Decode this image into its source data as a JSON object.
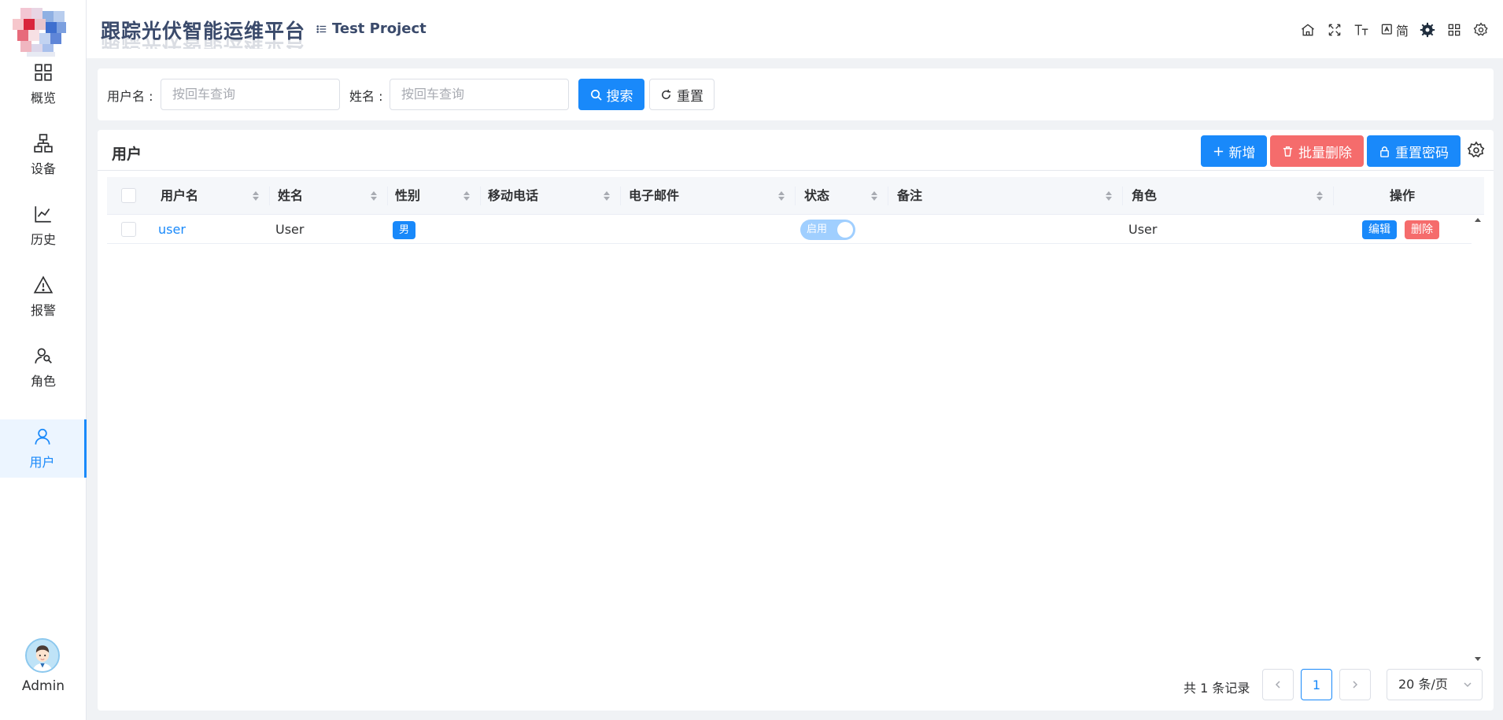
{
  "app": {
    "title": "跟踪光伏智能运维平台",
    "project": "Test Project"
  },
  "header_tools": {
    "lang_label": "简"
  },
  "sidebar": {
    "items": [
      {
        "label": "概览",
        "icon": "grid-icon"
      },
      {
        "label": "设备",
        "icon": "hierarchy-icon"
      },
      {
        "label": "历史",
        "icon": "line-chart-icon"
      },
      {
        "label": "报警",
        "icon": "warning-icon"
      },
      {
        "label": "角色",
        "icon": "roles-icon"
      },
      {
        "label": "用户",
        "icon": "user-icon",
        "active": true
      }
    ],
    "user_name": "Admin"
  },
  "search": {
    "username_label": "用户名 :",
    "username_placeholder": "按回车查询",
    "name_label": "姓名 :",
    "name_placeholder": "按回车查询",
    "search_button": "搜索",
    "reset_button": "重置"
  },
  "table_panel": {
    "title": "用户",
    "add_button": "新增",
    "batch_delete_button": "批量删除",
    "reset_password_button": "重置密码",
    "columns": [
      "用户名",
      "姓名",
      "性别",
      "移动电话",
      "电子邮件",
      "状态",
      "备注",
      "角色",
      "操作"
    ],
    "rows": [
      {
        "username": "user",
        "name": "User",
        "gender": "男",
        "phone": "",
        "email": "",
        "status": "启用",
        "remark": "",
        "role": "User",
        "edit": "编辑",
        "delete": "删除"
      }
    ]
  },
  "pagination": {
    "total": "共 1 条记录",
    "current_page": "1",
    "page_size": "20 条/页"
  },
  "colors": {
    "primary": "#1989fa",
    "danger": "#f56c6c",
    "title": "#3a4a6b"
  }
}
